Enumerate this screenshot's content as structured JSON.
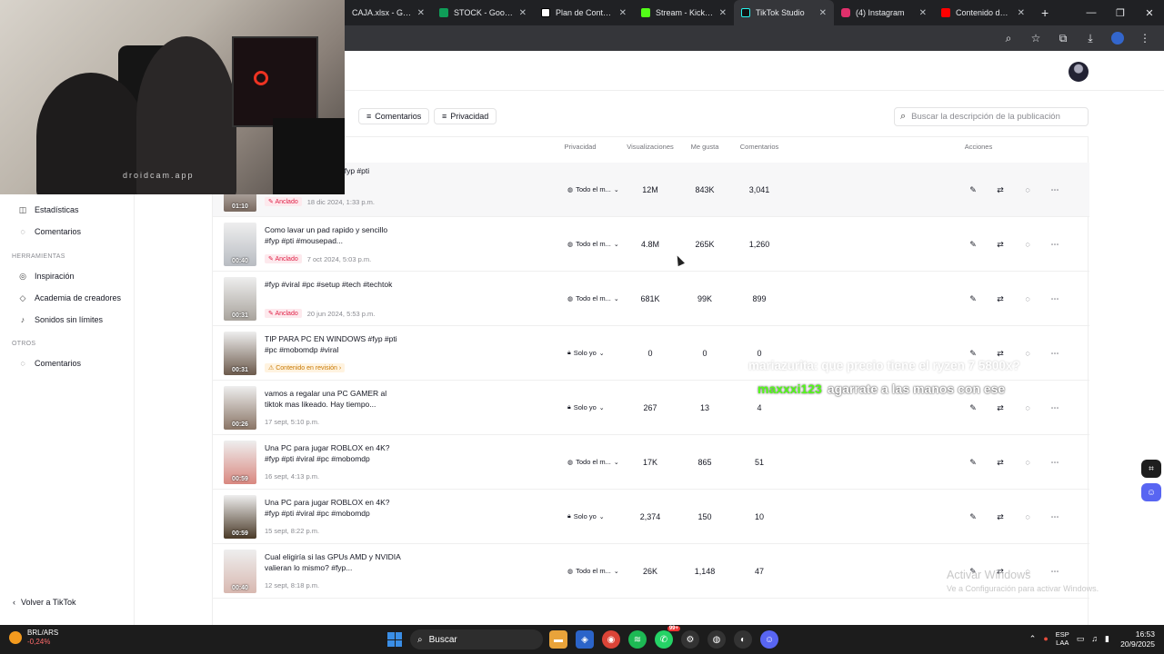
{
  "browser": {
    "tabs": [
      {
        "label": "CAJA.xlsx - Googl",
        "color": "#0f9d58",
        "active": false
      },
      {
        "label": "STOCK - Google S",
        "color": "#0f9d58",
        "active": false
      },
      {
        "label": "Plan de Contenid",
        "color": "#ffffff",
        "active": false
      },
      {
        "label": "Stream - Kick Das",
        "color": "#53fc18",
        "active": false
      },
      {
        "label": "TikTok Studio",
        "color": "#000000",
        "active": true
      },
      {
        "label": "(4) Instagram",
        "color": "#e1306c",
        "active": false
      },
      {
        "label": "Contenido del ca",
        "color": "#ff0000",
        "active": false
      }
    ],
    "new_tab": "+"
  },
  "sidebar": {
    "items_top": [
      {
        "icon": "chart-icon",
        "glyph": "◫",
        "label": "Estadísticas"
      },
      {
        "icon": "comment-icon",
        "glyph": "◌",
        "label": "Comentarios"
      }
    ],
    "section_tools": "HERRAMIENTAS",
    "tools": [
      {
        "icon": "bulb-icon",
        "glyph": "◎",
        "label": "Inspiración"
      },
      {
        "icon": "academy-icon",
        "glyph": "◇",
        "label": "Academia de creadores"
      },
      {
        "icon": "music-icon",
        "glyph": "♪",
        "label": "Sonidos sin límites"
      }
    ],
    "section_other": "OTROS",
    "other": [
      {
        "icon": "comment-icon",
        "glyph": "◌",
        "label": "Comentarios"
      }
    ],
    "back": "Volver a TikTok"
  },
  "filters": {
    "comments": "Comentarios",
    "privacy": "Privacidad",
    "search_placeholder": "Buscar la descripción de la publicación"
  },
  "table": {
    "headers": {
      "privacy": "Privacidad",
      "views": "Visualizaciones",
      "likes": "Me gusta",
      "comments": "Comentarios",
      "actions": "Acciones"
    },
    "rows": [
      {
        "desc": "#fyp #pti",
        "duration": "01:10",
        "badge": "Anclado",
        "badge_type": "pin",
        "date": "18 dic 2024, 1:33 p.m.",
        "privacy": "Todo el m...",
        "privacy_icon": "globe-icon",
        "views": "12M",
        "likes": "843K",
        "comments": "3,041",
        "thumb": "#7a6a60"
      },
      {
        "desc": "Como lavar un pad rapido y sencillo #fyp #pti #mousepad...",
        "duration": "00:40",
        "badge": "Anclado",
        "badge_type": "pin",
        "date": "7 oct 2024, 5:03 p.m.",
        "privacy": "Todo el m...",
        "privacy_icon": "globe-icon",
        "views": "4.8M",
        "likes": "265K",
        "comments": "1,260",
        "thumb": "#b8bcc2"
      },
      {
        "desc": "#fyp #viral #pc #setup #tech #techtok",
        "duration": "00:31",
        "badge": "Anclado",
        "badge_type": "pin",
        "date": "20 jun 2024, 5:53 p.m.",
        "privacy": "Todo el m...",
        "privacy_icon": "globe-icon",
        "views": "681K",
        "likes": "99K",
        "comments": "899",
        "thumb": "#a8a39c"
      },
      {
        "desc": "TIP PARA PC EN WINDOWS #fyp #pti #pc #mobomdp #viral",
        "duration": "00:31",
        "badge": "Contenido en revisión",
        "badge_type": "review",
        "date": "",
        "privacy": "Solo yo",
        "privacy_icon": "lock-icon",
        "views": "0",
        "likes": "0",
        "comments": "0",
        "thumb": "#6c5a4c"
      },
      {
        "desc": "vamos a regalar una PC GAMER al tiktok mas likeado. Hay tiempo...",
        "duration": "00:26",
        "badge": "",
        "badge_type": "",
        "date": "17 sept, 5:10 p.m.",
        "privacy": "Solo yo",
        "privacy_icon": "lock-icon",
        "views": "267",
        "likes": "13",
        "comments": "4",
        "thumb": "#8a7566"
      },
      {
        "desc": "Una PC para jugar ROBLOX en 4K? #fyp #pti #viral #pc #mobomdp",
        "duration": "00:59",
        "badge": "",
        "badge_type": "",
        "date": "16 sept, 4:13 p.m.",
        "privacy": "Todo el m...",
        "privacy_icon": "globe-icon",
        "views": "17K",
        "likes": "865",
        "comments": "51",
        "thumb": "#d98880"
      },
      {
        "desc": "Una PC para jugar ROBLOX en 4K? #fyp #pti #viral #pc #mobomdp",
        "duration": "00:59",
        "badge": "",
        "badge_type": "",
        "date": "15 sept, 8:22 p.m.",
        "privacy": "Solo yo",
        "privacy_icon": "lock-icon",
        "views": "2,374",
        "likes": "150",
        "comments": "10",
        "thumb": "#4a3a28"
      },
      {
        "desc": "Cual eligiría si las GPUs AMD y NVIDIA valieran lo mismo? #fyp...",
        "duration": "00:40",
        "badge": "",
        "badge_type": "",
        "date": "12 sept, 8:18 p.m.",
        "privacy": "Todo el m...",
        "privacy_icon": "globe-icon",
        "views": "26K",
        "likes": "1,148",
        "comments": "47",
        "thumb": "#d8b8b0"
      }
    ]
  },
  "overlay": {
    "webcam_watermark": "droidcam.app",
    "chat_line1": "mariazurita: que precio tiene el ryzen 7 5800x?",
    "chat_user": "maxxxi123",
    "chat_msg": "agarrate a las manos con ese",
    "win_activate_title": "Activar Windows",
    "win_activate_sub": "Ve a Configuración para activar Windows."
  },
  "taskbar": {
    "ticker": "BRL/ARS",
    "ticker_change": "-0,24%",
    "search": "Buscar",
    "lang1": "ESP",
    "lang2": "LAA",
    "time": "16:53",
    "date": "20/9/2025",
    "whatsapp_badge": "99+"
  },
  "colors": {
    "accent": "#fe2c55",
    "pin_bg": "#fde9ed",
    "pin_text": "#e01f45"
  }
}
